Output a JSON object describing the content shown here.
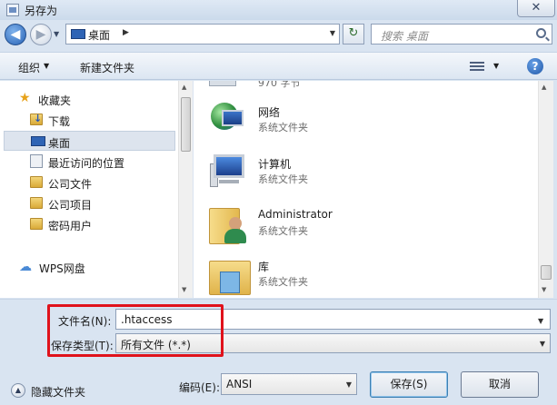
{
  "window": {
    "title": "另存为",
    "close_glyph": "✕"
  },
  "nav": {
    "back_glyph": "◀",
    "forward_glyph": "▶",
    "address": "桌面",
    "address_arrow": "▶",
    "search_placeholder": "搜索 桌面",
    "refresh_glyph": "↻"
  },
  "toolbar": {
    "organize": "组织",
    "new_folder": "新建文件夹",
    "help": "?"
  },
  "sidebar": {
    "favorites": "收藏夹",
    "items": [
      {
        "label": "下载",
        "icon": "download-folder-icon"
      },
      {
        "label": "桌面",
        "icon": "desktop-icon"
      },
      {
        "label": "最近访问的位置",
        "icon": "recent-places-icon"
      },
      {
        "label": "公司文件",
        "icon": "folder-icon"
      },
      {
        "label": "公司项目",
        "icon": "folder-icon"
      },
      {
        "label": "密码用户",
        "icon": "folder-icon"
      }
    ],
    "wps": "WPS网盘",
    "selected": "桌面"
  },
  "files": {
    "partial_text": "970 字节",
    "items": [
      {
        "name": "网络",
        "type": "系统文件夹",
        "icon": "network-icon"
      },
      {
        "name": "计算机",
        "type": "系统文件夹",
        "icon": "computer-icon"
      },
      {
        "name": "Administrator",
        "type": "系统文件夹",
        "icon": "user-folder-icon"
      },
      {
        "name": "库",
        "type": "系统文件夹",
        "icon": "library-icon"
      }
    ]
  },
  "form": {
    "filename_label": "文件名(N):",
    "filename_value": ".htaccess",
    "filetype_label": "保存类型(T):",
    "filetype_value": "所有文件 (*.*)",
    "highlight_color": "#e0121b"
  },
  "footer": {
    "hide_folders": "隐藏文件夹",
    "encoding_label": "编码(E):",
    "encoding_value": "ANSI",
    "save": "保存(S)",
    "cancel": "取消"
  }
}
